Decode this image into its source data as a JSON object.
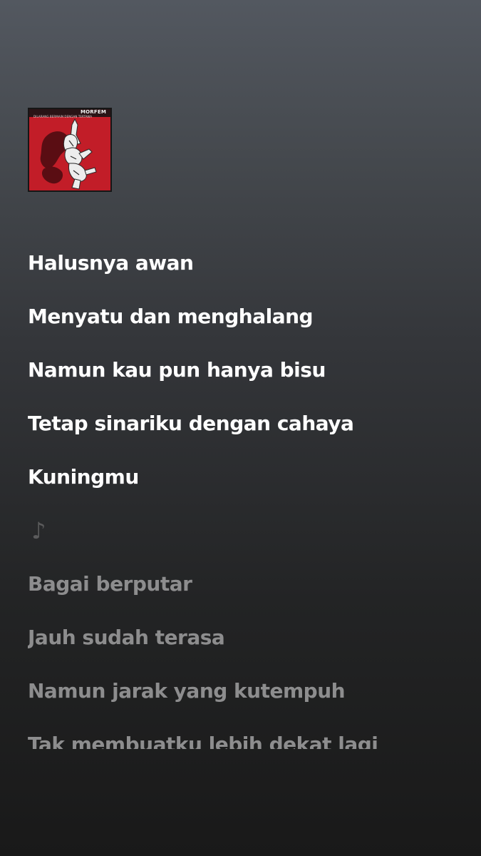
{
  "album": {
    "band": "MORFEM",
    "title": "DILARANG BERMAIN DENGAN TERTAWA",
    "colors": {
      "background": "#c21d28",
      "figure": "#ededed",
      "shadow": "#5a0d13"
    }
  },
  "lyrics": {
    "lines": [
      {
        "text": "Halusnya awan",
        "state": "active"
      },
      {
        "text": "Menyatu dan menghalang",
        "state": "active"
      },
      {
        "text": "Namun kau pun hanya bisu",
        "state": "active"
      },
      {
        "text": "Tetap sinariku dengan cahaya",
        "state": "active"
      },
      {
        "text": "Kuningmu",
        "state": "active"
      },
      {
        "text": "♪",
        "state": "instrumental"
      },
      {
        "text": "Bagai berputar",
        "state": "upcoming"
      },
      {
        "text": "Jauh sudah terasa",
        "state": "upcoming"
      },
      {
        "text": "Namun jarak yang kutempuh",
        "state": "upcoming"
      },
      {
        "text": "Tak membuatku lebih dekat lagi",
        "state": "upcoming"
      }
    ]
  },
  "theme": {
    "active_text": "#ffffff",
    "upcoming_text": "#8d8d8e",
    "background_top": "#535860",
    "background_bottom": "#191919"
  }
}
